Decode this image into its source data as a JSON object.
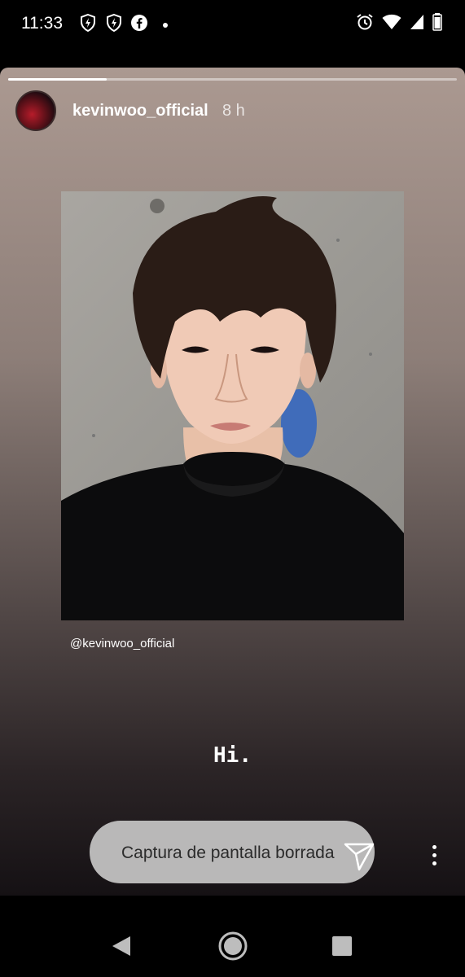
{
  "status_bar": {
    "time": "11:33",
    "left_icons": [
      "shield-bolt-icon",
      "shield-bolt-icon",
      "facebook-icon",
      "dot-icon"
    ],
    "right_icons": [
      "alarm-icon",
      "wifi-icon",
      "signal-icon",
      "battery-icon"
    ]
  },
  "story": {
    "progress": 0.22,
    "username": "kevinwoo_official",
    "age": "8 h",
    "mention": "@kevinwoo_official",
    "caption": "Hi.",
    "reply_field": "Captura de pantalla borrada"
  },
  "nav": {
    "icons": [
      "back-icon",
      "home-icon",
      "recents-icon"
    ]
  }
}
